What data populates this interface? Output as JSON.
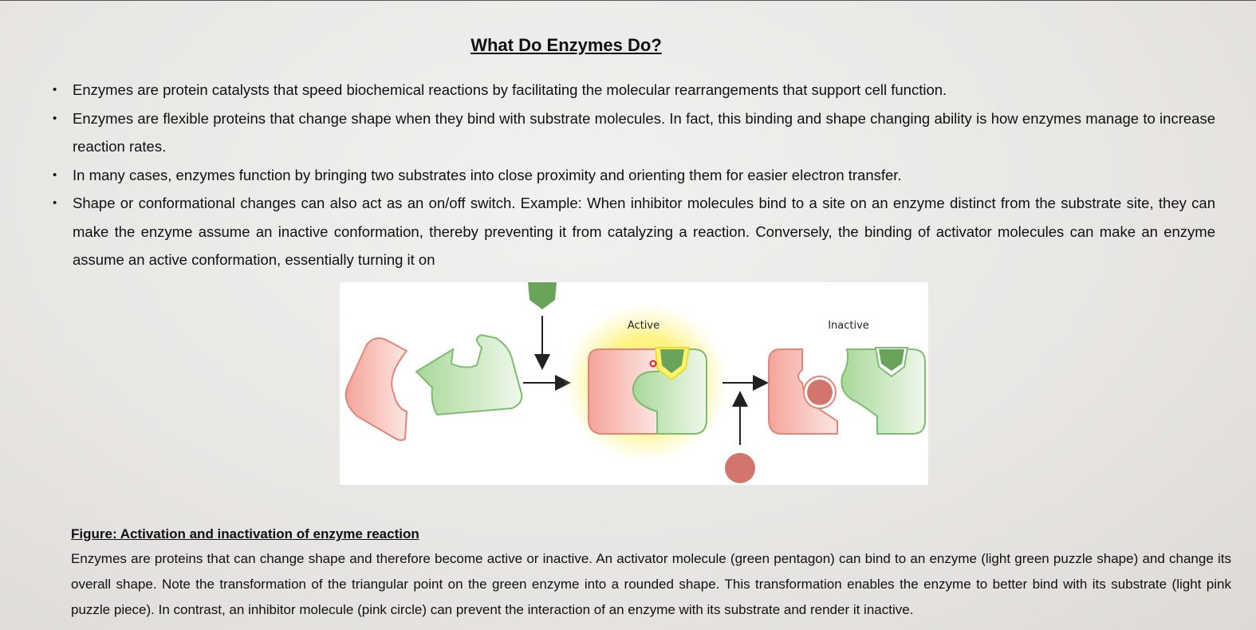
{
  "page": {
    "title": "What Do Enzymes Do?"
  },
  "bullets": [
    "Enzymes are protein catalysts that speed biochemical reactions by facilitating the molecular rearrangements that support cell function.",
    "Enzymes are flexible proteins that change shape when they bind with substrate molecules. In fact, this binding and shape changing ability is how enzymes manage to increase reaction rates.",
    "In many cases, enzymes function by bringing two substrates into close proximity and orienting them for easier electron transfer.",
    "Shape or conformational changes can also act as an on/off switch. Example: When inhibitor molecules bind to a site on an enzyme distinct from the substrate site, they can make the enzyme assume an inactive conformation, thereby preventing it from catalyzing a reaction. Conversely, the binding of activator molecules can make an enzyme assume an active conformation, essentially turning it on"
  ],
  "figure": {
    "label_active": "Active",
    "label_inactive": "Inactive",
    "colors": {
      "substrate_pink": "#f4a49a",
      "enzyme_green": "#a9d89a",
      "activator_green": "#6aa45a",
      "inhibitor_red": "#d2756c",
      "glow_yellow": "#fff27a"
    }
  },
  "caption": {
    "title": "Figure: Activation and inactivation of enzyme reaction",
    "text": "Enzymes are proteins that can change shape and therefore become active or inactive. An activator molecule (green pentagon) can bind to an enzyme (light green puzzle shape) and change its overall shape. Note the transformation of the triangular point on the green enzyme into a rounded shape. This transformation enables the enzyme to better bind with its substrate (light pink puzzle piece). In contrast, an inhibitor molecule (pink circle) can prevent the interaction of an enzyme with its substrate and render it inactive."
  }
}
